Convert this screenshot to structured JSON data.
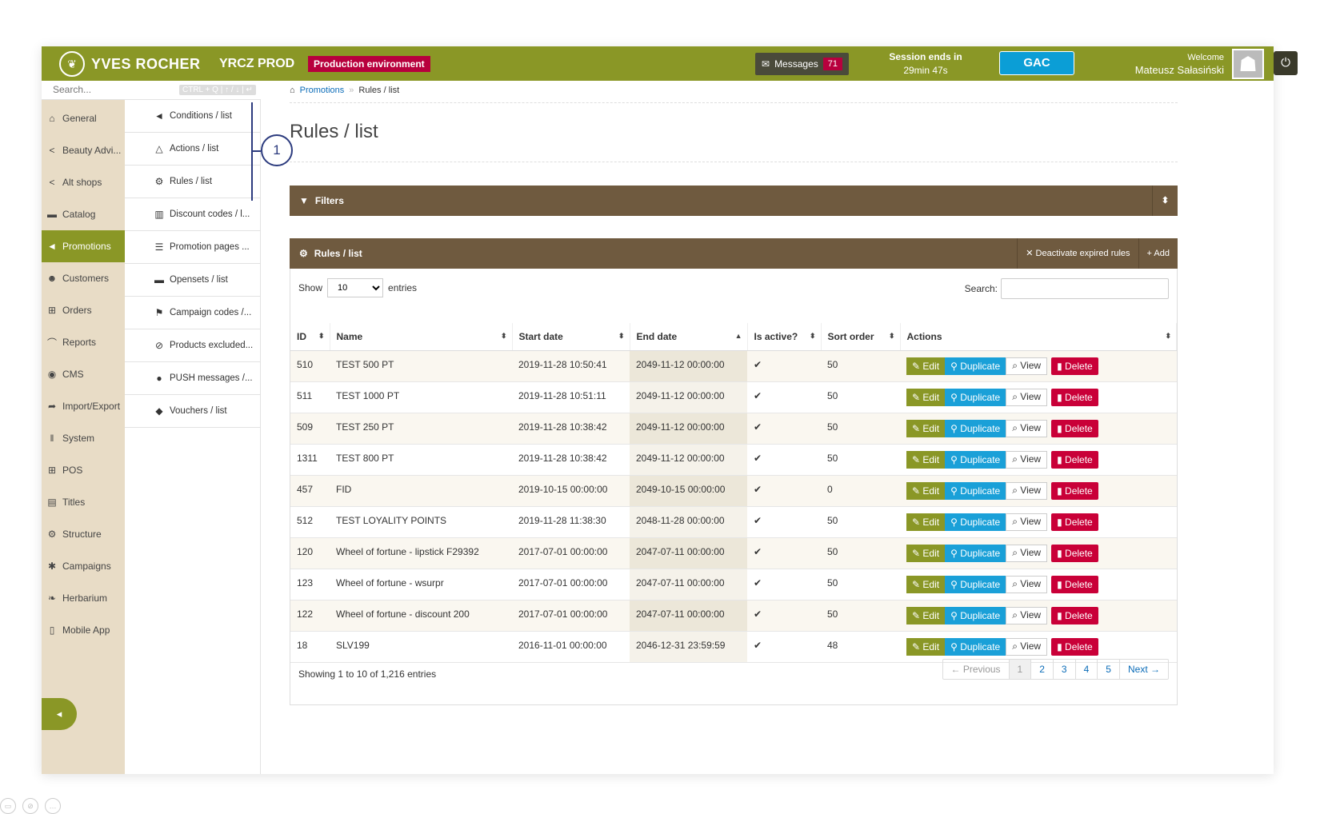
{
  "header": {
    "brand": "YVES ROCHER",
    "env_name": "YRCZ PROD",
    "env_badge": "Production environment",
    "messages_label": "Messages",
    "messages_count": "71",
    "session_label": "Session ends in",
    "session_time": "29min 47s",
    "gac_label": "GAC",
    "welcome_label": "Welcome",
    "user_name": "Mateusz Sałasiński"
  },
  "search": {
    "placeholder": "Search...",
    "hint": "CTRL + Q | ↑ / ↓ | ↵"
  },
  "nav": [
    {
      "label": "General",
      "icon": "home-icon",
      "glyph": "⌂"
    },
    {
      "label": "Beauty Advi...",
      "icon": "share-icon",
      "glyph": "<"
    },
    {
      "label": "Alt shops",
      "icon": "share-icon",
      "glyph": "<"
    },
    {
      "label": "Catalog",
      "icon": "folder-icon",
      "glyph": "▬"
    },
    {
      "label": "Promotions",
      "icon": "bullhorn-icon",
      "glyph": "◄",
      "active": true
    },
    {
      "label": "Customers",
      "icon": "users-icon",
      "glyph": "☻"
    },
    {
      "label": "Orders",
      "icon": "cart-icon",
      "glyph": "⊞"
    },
    {
      "label": "Reports",
      "icon": "chart-icon",
      "glyph": "⌒"
    },
    {
      "label": "CMS",
      "icon": "globe-icon",
      "glyph": "◉"
    },
    {
      "label": "Import/Export",
      "icon": "arrow-icon",
      "glyph": "➦"
    },
    {
      "label": "System",
      "icon": "sliders-icon",
      "glyph": "‖"
    },
    {
      "label": "POS",
      "icon": "cart-icon",
      "glyph": "⊞"
    },
    {
      "label": "Titles",
      "icon": "list-icon",
      "glyph": "▤"
    },
    {
      "label": "Structure",
      "icon": "gear-icon",
      "glyph": "⚙"
    },
    {
      "label": "Campaigns",
      "icon": "asterisk-icon",
      "glyph": "✱"
    },
    {
      "label": "Herbarium",
      "icon": "leaf-icon",
      "glyph": "❧"
    },
    {
      "label": "Mobile App",
      "icon": "mobile-icon",
      "glyph": "▯"
    }
  ],
  "subnav": [
    {
      "label": "Conditions / list",
      "icon": "bullhorn-icon",
      "glyph": "◄"
    },
    {
      "label": "Actions / list",
      "icon": "flask-icon",
      "glyph": "△"
    },
    {
      "label": "Rules / list",
      "icon": "gears-icon",
      "glyph": "⚙"
    },
    {
      "label": "Discount codes / l...",
      "icon": "barcode-icon",
      "glyph": "▥"
    },
    {
      "label": "Promotion pages ...",
      "icon": "list-icon",
      "glyph": "☰"
    },
    {
      "label": "Opensets / list",
      "icon": "folder-icon",
      "glyph": "▬"
    },
    {
      "label": "Campaign codes /...",
      "icon": "flag-icon",
      "glyph": "⚑"
    },
    {
      "label": "Products excluded...",
      "icon": "ban-icon",
      "glyph": "⊘"
    },
    {
      "label": "PUSH messages /...",
      "icon": "comment-icon",
      "glyph": "●"
    },
    {
      "label": "Vouchers / list",
      "icon": "tag-icon",
      "glyph": "◆"
    }
  ],
  "callout": "1",
  "breadcrumb": {
    "link": "Promotions",
    "sep": "»",
    "current": "Rules / list"
  },
  "page_title": "Rules / list",
  "filters": {
    "title": "Filters",
    "toggle": "⬍"
  },
  "list": {
    "title": "Rules / list",
    "deactivate_label": "✕ Deactivate expired rules",
    "add_label": "+ Add",
    "show_label": "Show",
    "entries_label": "entries",
    "page_size": "10",
    "search_label": "Search:",
    "columns": [
      "ID",
      "Name",
      "Start date",
      "End date",
      "Is active?",
      "Sort order",
      "Actions"
    ],
    "rows": [
      {
        "id": "510",
        "name": "TEST 500 PT",
        "start": "2019-11-28 10:50:41",
        "end": "2049-11-12 00:00:00",
        "active": "✔",
        "sort": "50"
      },
      {
        "id": "511",
        "name": "TEST 1000 PT",
        "start": "2019-11-28 10:51:11",
        "end": "2049-11-12 00:00:00",
        "active": "✔",
        "sort": "50"
      },
      {
        "id": "509",
        "name": "TEST 250 PT",
        "start": "2019-11-28 10:38:42",
        "end": "2049-11-12 00:00:00",
        "active": "✔",
        "sort": "50"
      },
      {
        "id": "1311",
        "name": "TEST 800 PT",
        "start": "2019-11-28 10:38:42",
        "end": "2049-11-12 00:00:00",
        "active": "✔",
        "sort": "50"
      },
      {
        "id": "457",
        "name": "FID",
        "start": "2019-10-15 00:00:00",
        "end": "2049-10-15 00:00:00",
        "active": "✔",
        "sort": "0"
      },
      {
        "id": "512",
        "name": "TEST LOYALITY POINTS",
        "start": "2019-11-28 11:38:30",
        "end": "2048-11-28 00:00:00",
        "active": "✔",
        "sort": "50"
      },
      {
        "id": "120",
        "name": "Wheel of fortune - lipstick F29392",
        "start": "2017-07-01 00:00:00",
        "end": "2047-07-11 00:00:00",
        "active": "✔",
        "sort": "50"
      },
      {
        "id": "123",
        "name": "Wheel of fortune - wsurpr",
        "start": "2017-07-01 00:00:00",
        "end": "2047-07-11 00:00:00",
        "active": "✔",
        "sort": "50"
      },
      {
        "id": "122",
        "name": "Wheel of fortune - discount 200",
        "start": "2017-07-01 00:00:00",
        "end": "2047-07-11 00:00:00",
        "active": "✔",
        "sort": "50"
      },
      {
        "id": "18",
        "name": "SLV199",
        "start": "2016-11-01 00:00:00",
        "end": "2046-12-31 23:59:59",
        "active": "✔",
        "sort": "48"
      }
    ],
    "actions": {
      "edit": "✎ Edit",
      "duplicate": "⚲ Duplicate",
      "view": "⌕ View",
      "delete": "▮ Delete"
    },
    "summary": "Showing 1 to 10 of 1,216 entries",
    "pager": [
      "← Previous",
      "1",
      "2",
      "3",
      "4",
      "5",
      "Next →"
    ]
  }
}
